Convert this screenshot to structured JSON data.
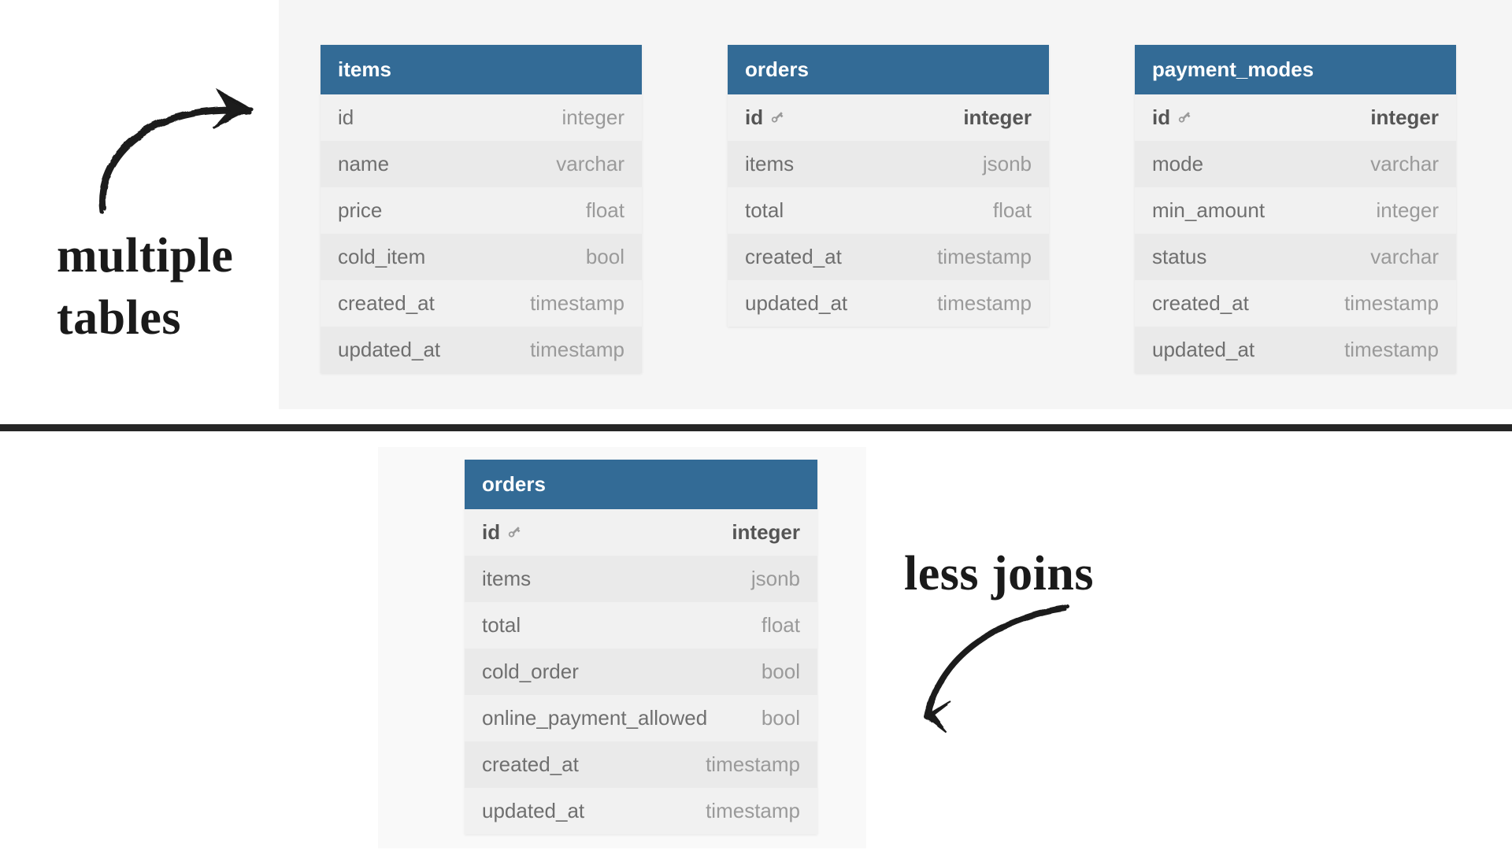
{
  "annotations": {
    "top": "multiple\ntables",
    "bottom": "less joins"
  },
  "key_icon_name": "key-icon",
  "tables": {
    "items": {
      "title": "items",
      "columns": [
        {
          "name": "id",
          "type": "integer",
          "pk": false
        },
        {
          "name": "name",
          "type": "varchar",
          "pk": false
        },
        {
          "name": "price",
          "type": "float",
          "pk": false
        },
        {
          "name": "cold_item",
          "type": "bool",
          "pk": false
        },
        {
          "name": "created_at",
          "type": "timestamp",
          "pk": false
        },
        {
          "name": "updated_at",
          "type": "timestamp",
          "pk": false
        }
      ]
    },
    "orders": {
      "title": "orders",
      "columns": [
        {
          "name": "id",
          "type": "integer",
          "pk": true
        },
        {
          "name": "items",
          "type": "jsonb",
          "pk": false
        },
        {
          "name": "total",
          "type": "float",
          "pk": false
        },
        {
          "name": "created_at",
          "type": "timestamp",
          "pk": false
        },
        {
          "name": "updated_at",
          "type": "timestamp",
          "pk": false
        }
      ]
    },
    "payment_modes": {
      "title": "payment_modes",
      "columns": [
        {
          "name": "id",
          "type": "integer",
          "pk": true
        },
        {
          "name": "mode",
          "type": "varchar",
          "pk": false
        },
        {
          "name": "min_amount",
          "type": "integer",
          "pk": false
        },
        {
          "name": "status",
          "type": "varchar",
          "pk": false
        },
        {
          "name": "created_at",
          "type": "timestamp",
          "pk": false
        },
        {
          "name": "updated_at",
          "type": "timestamp",
          "pk": false
        }
      ]
    },
    "orders_denormalized": {
      "title": "orders",
      "columns": [
        {
          "name": "id",
          "type": "integer",
          "pk": true
        },
        {
          "name": "items",
          "type": "jsonb",
          "pk": false
        },
        {
          "name": "total",
          "type": "float",
          "pk": false
        },
        {
          "name": "cold_order",
          "type": "bool",
          "pk": false
        },
        {
          "name": "online_payment_allowed",
          "type": "bool",
          "pk": false
        },
        {
          "name": "created_at",
          "type": "timestamp",
          "pk": false
        },
        {
          "name": "updated_at",
          "type": "timestamp",
          "pk": false
        }
      ]
    }
  }
}
